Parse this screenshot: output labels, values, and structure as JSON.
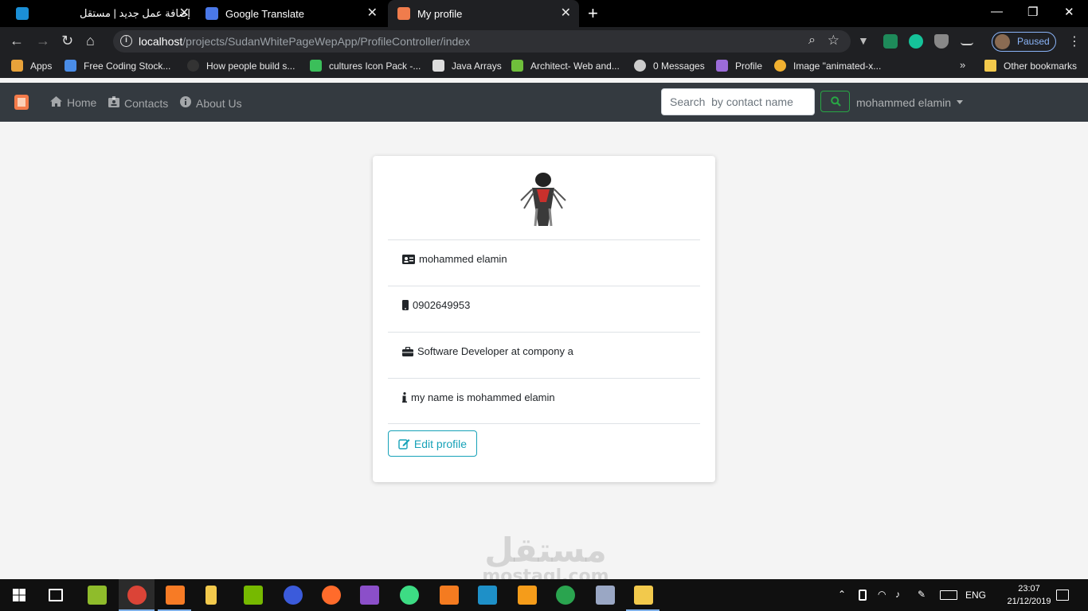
{
  "browser": {
    "tabs": [
      {
        "title": "إضافة عمل جديد | مستقل",
        "icon": "mostaql-favicon-icon"
      },
      {
        "title": "Google Translate",
        "icon": "google-translate-icon"
      },
      {
        "title": "My profile",
        "icon": "app-logo-icon",
        "active": true
      }
    ],
    "url": {
      "host": "localhost",
      "path": "/projects/SudanWhitePageWepApp/ProfileController/index"
    },
    "profile_status": "Paused",
    "bookmarks": [
      {
        "label": "Apps",
        "icon": "apps-grid-icon",
        "color": "#e8a23a"
      },
      {
        "label": "Free Coding Stock...",
        "icon": "infinity-icon",
        "color": "#4a8de8"
      },
      {
        "label": "How people build s...",
        "icon": "github-icon",
        "color": "#222222"
      },
      {
        "label": "cultures Icon Pack -...",
        "icon": "icon-pack-icon",
        "color": "#3bbf5a"
      },
      {
        "label": "Java Arrays",
        "icon": "java-icon",
        "color": "#dddddd"
      },
      {
        "label": "Architect- Web and...",
        "icon": "upwork-icon",
        "color": "#6fbf3b"
      },
      {
        "label": "0 Messages",
        "icon": "globe-icon",
        "color": "#cccccc"
      },
      {
        "label": "Profile",
        "icon": "profile-bookmark-icon",
        "color": "#9b6bd8"
      },
      {
        "label": "Image \"animated-x...",
        "icon": "star-burst-icon",
        "color": "#f0b030"
      }
    ],
    "other_bookmarks": "Other bookmarks"
  },
  "navbar": {
    "links": [
      {
        "label": "Home",
        "icon": "home-icon"
      },
      {
        "label": "Contacts",
        "icon": "contacts-icon"
      },
      {
        "label": "About Us",
        "icon": "info-circle-icon"
      }
    ],
    "search_placeholder": "Search  by contact name",
    "user_name": "mohammed elamin"
  },
  "profile": {
    "name": "mohammed elamin",
    "phone": "0902649953",
    "job": "Software Developer at compony a",
    "bio": "my name is mohammed elamin",
    "edit_label": "Edit profile"
  },
  "watermark": {
    "arabic": "مستقل",
    "latin": "mostaql.com"
  },
  "taskbar": {
    "language": "ENG",
    "time": "23:07",
    "date": "21/12/2019"
  },
  "colors": {
    "navbar": "#343a40",
    "success": "#28a745",
    "info": "#17a2b8",
    "brand": "#f47b4a"
  }
}
